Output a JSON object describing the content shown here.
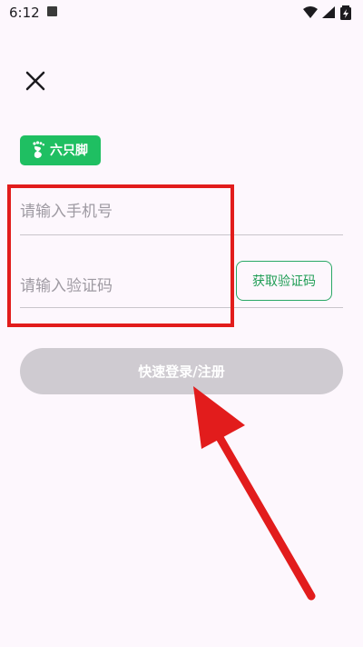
{
  "status_bar": {
    "time": "6:12",
    "icons": [
      "notification-app-icon",
      "wifi-icon",
      "signal-icon",
      "battery-icon"
    ]
  },
  "header": {
    "close_icon": "close-icon"
  },
  "brand": {
    "name": "六只脚",
    "icon": "footprint-icon",
    "color": "#1fbf62"
  },
  "form": {
    "phone_placeholder": "请输入手机号",
    "phone_value": "",
    "code_placeholder": "请输入验证码",
    "code_value": "",
    "get_code_label": "获取验证码",
    "submit_label": "快速登录/注册"
  },
  "annotations": {
    "highlight_color": "#e21c1c",
    "arrow_color": "#e21c1c"
  }
}
